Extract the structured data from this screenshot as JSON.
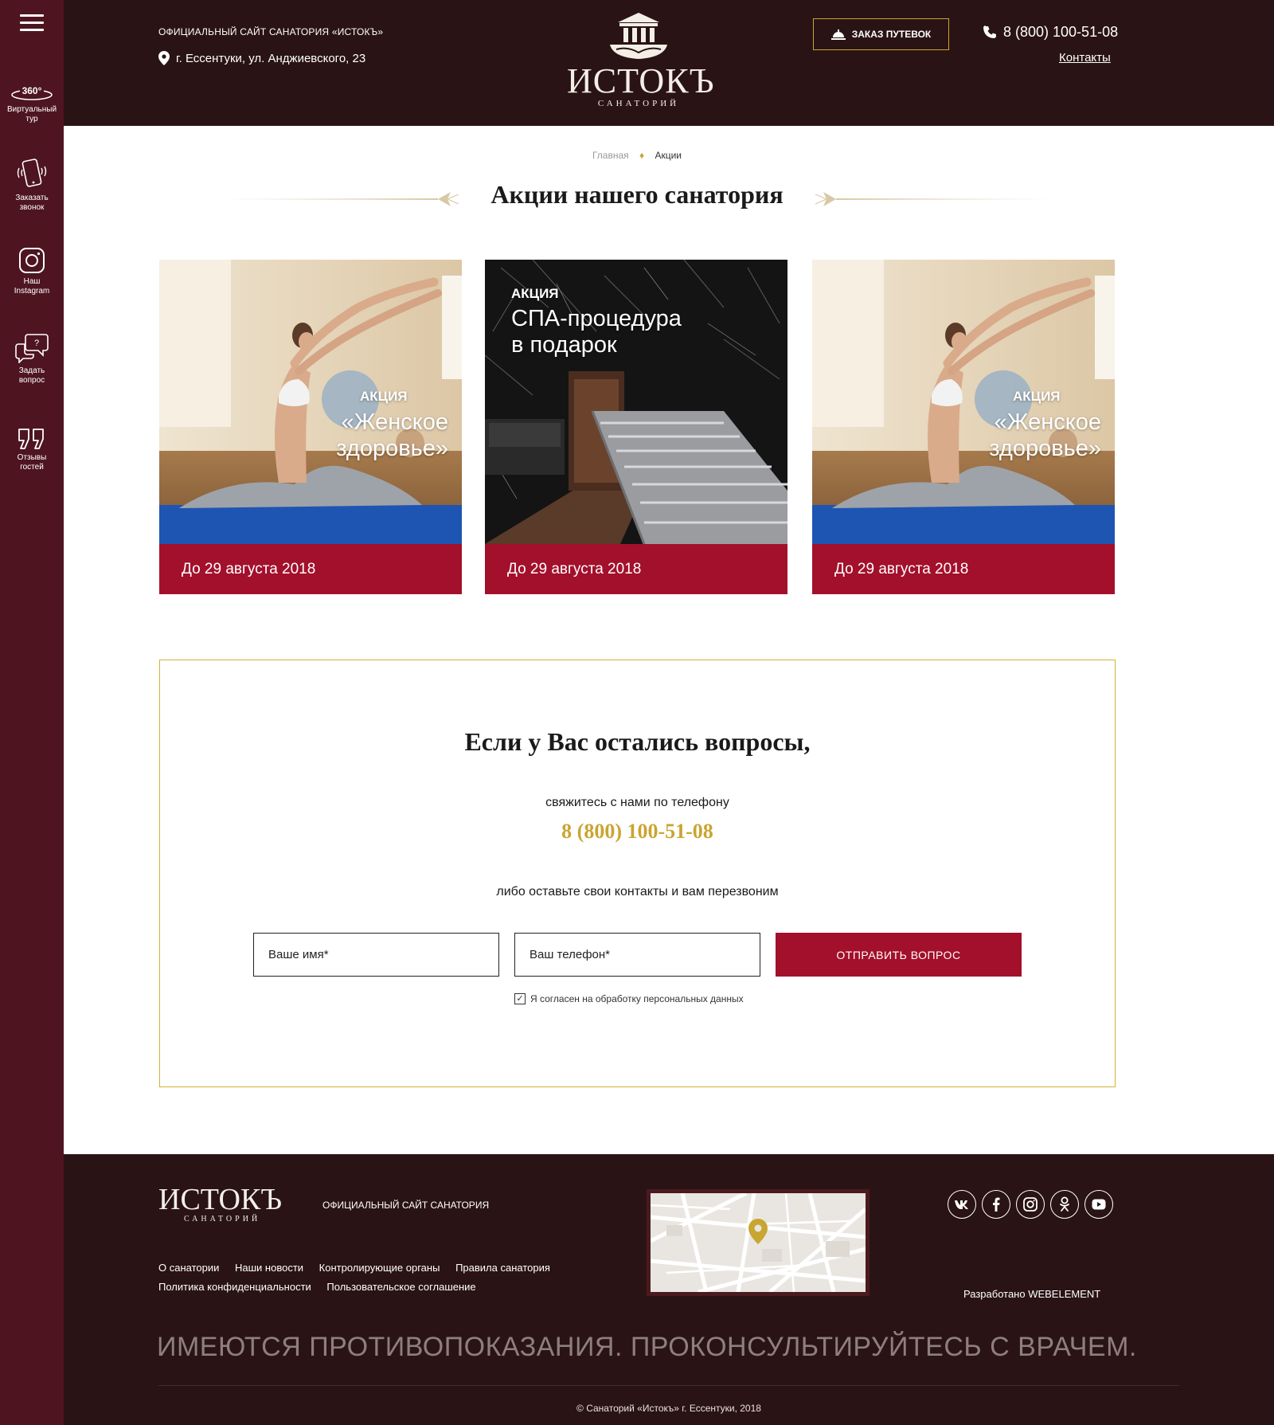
{
  "colors": {
    "sidebar_bg": "#4e1520",
    "header_bg": "#2a1315",
    "accent_red": "#a3102b",
    "accent_gold": "#c9a531"
  },
  "sidebar": {
    "menu_icon": "hamburger-icon",
    "items": [
      {
        "icon": "360-tour-icon",
        "label": "Виртуальный\nтур"
      },
      {
        "icon": "phone-callback-icon",
        "label": "Заказать\nзвонок"
      },
      {
        "icon": "instagram-icon",
        "label": "Наш\nInstagram"
      },
      {
        "icon": "question-chat-icon",
        "label": "Задать\nвопрос"
      },
      {
        "icon": "quote-icon",
        "label": "Отзывы\nгостей"
      }
    ],
    "tour_badge": "360°"
  },
  "header": {
    "official": "ОФИЦИАЛЬНЫЙ САЙТ САНАТОРИЯ «ИСТОКЪ»",
    "address": "г. Ессентуки, ул. Анджиевского, 23",
    "logo_name": "ИСТОКЪ",
    "logo_sub": "САНАТОРИЙ",
    "order_button": "ЗАКАЗ ПУТЕВОК",
    "phone": "8 (800) 100-51-08",
    "contacts_link": "Контакты"
  },
  "breadcrumb": {
    "home": "Главная",
    "separator": "♦",
    "current": "Акции"
  },
  "page_title": "Акции нашего санатория",
  "promos": [
    {
      "tag": "АКЦИЯ",
      "title": "«Женское\nздоровье»",
      "date": "До 29 августа 2018",
      "image": "yoga-photo"
    },
    {
      "tag": "АКЦИЯ",
      "title": "СПА-процедура\nв подарок",
      "date": "До 29 августа 2018",
      "image": "spa-photo"
    },
    {
      "tag": "АКЦИЯ",
      "title": "«Женское\nздоровье»",
      "date": "До 29 августа 2018",
      "image": "yoga-photo"
    }
  ],
  "question": {
    "title": "Если у Вас остались вопросы,",
    "text1": "свяжитесь с нами по телефону",
    "phone": "8 (800) 100-51-08",
    "text2": "либо оставьте свои контакты и вам перезвоним",
    "name_placeholder": "Ваше имя*",
    "phone_placeholder": "Ваш телефон*",
    "submit": "ОТПРАВИТЬ ВОПРОС",
    "agree_checked": true,
    "agree_label": "Я согласен на обработку персональных данных"
  },
  "footer": {
    "logo_name": "ИСТОКЪ",
    "logo_sub": "САНАТОРИЙ",
    "official": "ОФИЦИАЛЬНЫЙ САЙТ САНАТОРИЯ",
    "links_row1": [
      "О санатории",
      "Наши новости",
      "Контролирующие органы",
      "Правила санатория"
    ],
    "links_row2": [
      "Политика конфиденциальности",
      "Пользовательское соглашение"
    ],
    "social": [
      "vk-icon",
      "facebook-icon",
      "instagram-icon",
      "odnoklassniki-icon",
      "youtube-icon"
    ],
    "developer": "Разработано WEBELEMENT",
    "warning": "ИМЕЮТСЯ ПРОТИВОПОКАЗАНИЯ. ПРОКОНСУЛЬТИРУЙТЕСЬ С ВРАЧЕМ.",
    "copyright": "© Санаторий «Истокъ» г. Ессентуки, 2018"
  }
}
